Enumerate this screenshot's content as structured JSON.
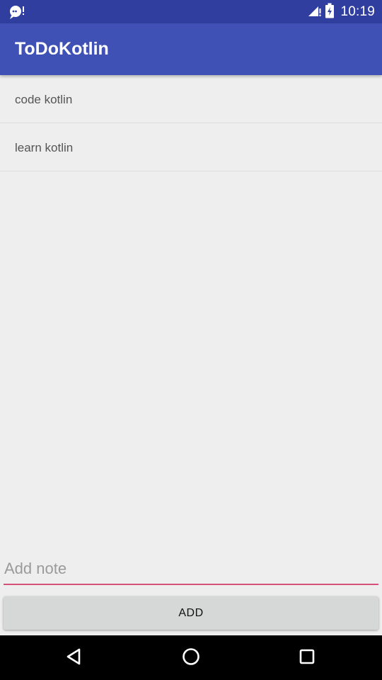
{
  "status_bar": {
    "time": "10:19",
    "icons": [
      "notification-icon",
      "signal-icon",
      "battery-icon"
    ]
  },
  "app_bar": {
    "title": "ToDoKotlin"
  },
  "todos": {
    "items": [
      {
        "text": "code kotlin"
      },
      {
        "text": "learn kotlin"
      }
    ]
  },
  "input": {
    "value": "",
    "placeholder": "Add note"
  },
  "add_button": {
    "label": "ADD"
  },
  "nav_bar": {
    "buttons": [
      "back-icon",
      "home-icon",
      "recents-icon"
    ]
  },
  "colors": {
    "status_bar": "#303f9f",
    "app_bar": "#3f51b5",
    "accent": "#d6507a",
    "background": "#eeeeee"
  }
}
